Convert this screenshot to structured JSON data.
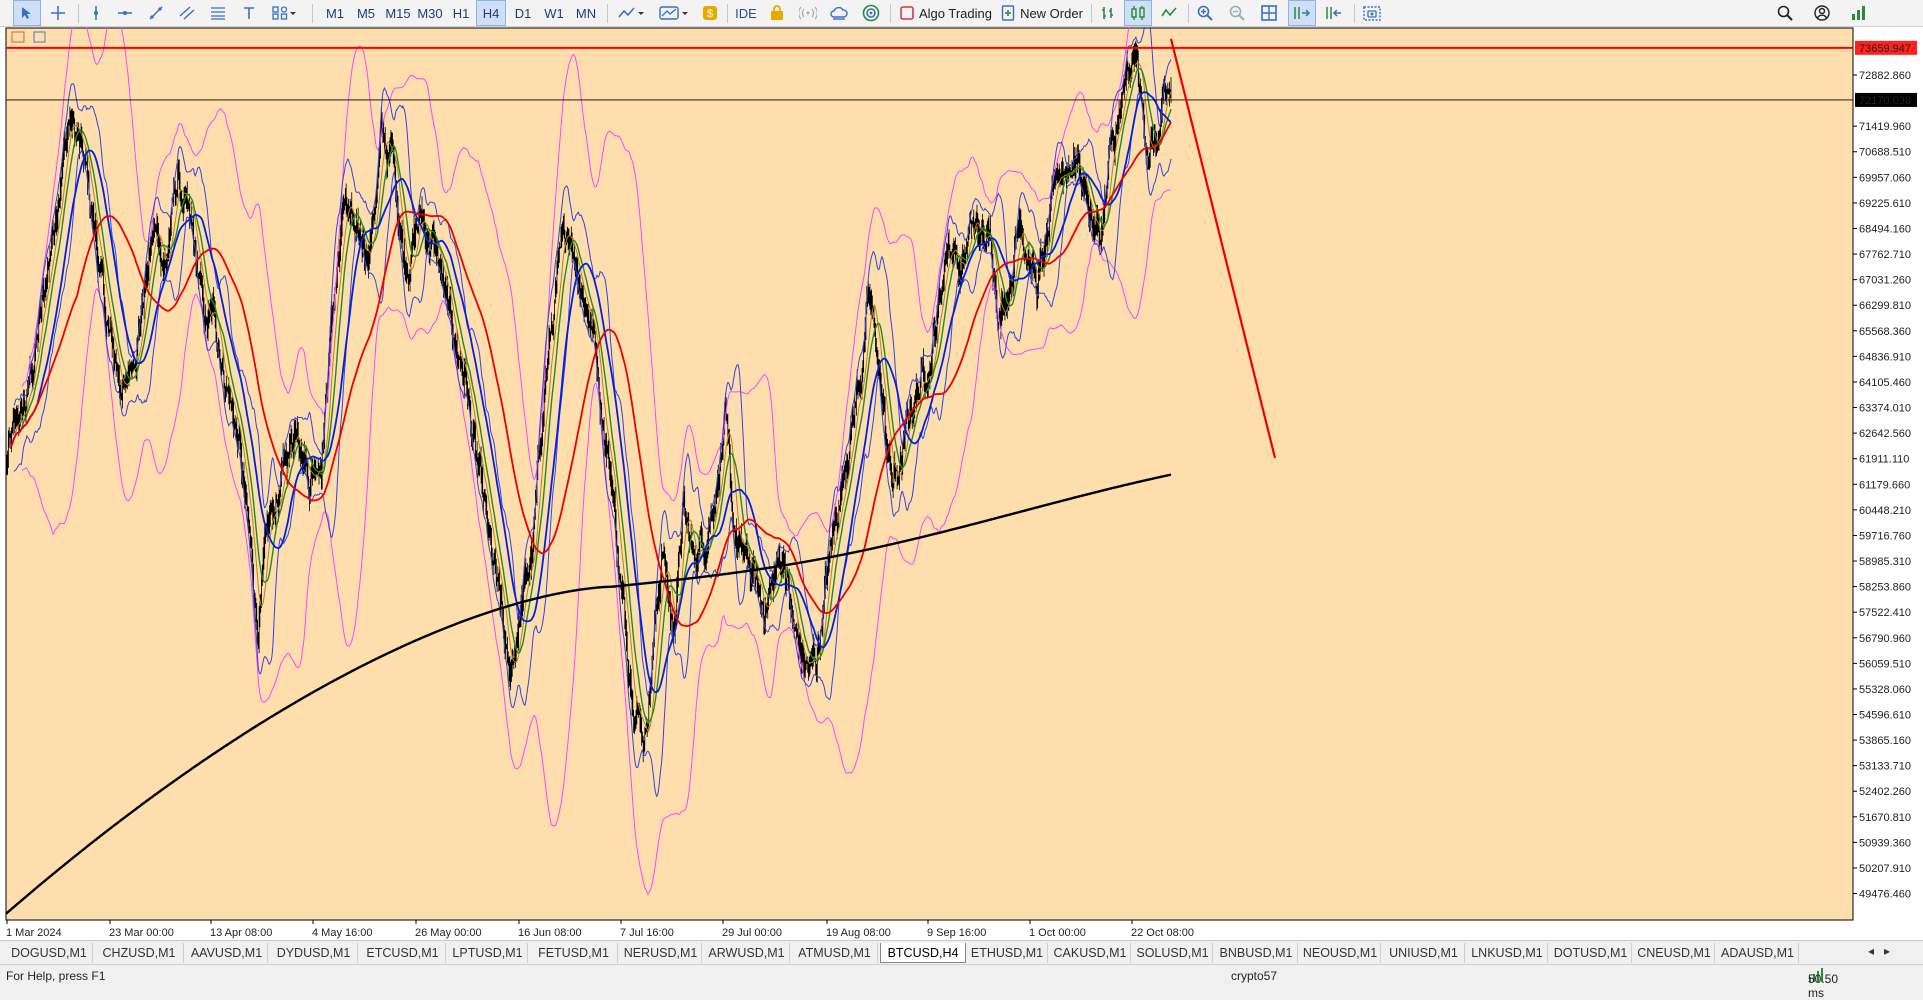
{
  "toolbar": {
    "timeframes": [
      "M1",
      "M5",
      "M15",
      "M30",
      "H1",
      "H4",
      "D1",
      "W1",
      "MN"
    ],
    "active_timeframe": "H4",
    "ide_label": "IDE",
    "algo_trading_label": "Algo Trading",
    "new_order_label": "New Order",
    "icons": [
      "cursor-icon",
      "crosshair-icon",
      "vertical-line-icon",
      "horizontal-line-icon",
      "trendline-icon",
      "channel-icon",
      "fibonacci-icon",
      "text-icon",
      "shapes-icon",
      "indicators-icon",
      "templates-icon",
      "market-icon",
      "lock-icon",
      "signals-icon",
      "cloud-icon",
      "vps-icon",
      "bar-chart-icon",
      "candle-chart-icon",
      "line-chart-icon",
      "zoom-in-icon",
      "zoom-out-icon",
      "tile-windows-icon",
      "autoscroll-icon",
      "chart-shift-icon",
      "screenshot-icon",
      "search-icon",
      "account-icon",
      "signal-level-icon"
    ]
  },
  "chart": {
    "symbol": "BTCUSD,H4",
    "background_color": "#FFDEAD",
    "price_scale": [
      "72882.860",
      "71419.960",
      "70688.510",
      "69957.060",
      "69225.610",
      "68494.160",
      "67762.710",
      "67031.260",
      "66299.810",
      "65568.360",
      "64836.910",
      "64105.460",
      "63374.010",
      "62642.560",
      "61911.110",
      "61179.660",
      "60448.210",
      "59716.760",
      "58985.310",
      "58253.860",
      "57522.410",
      "56790.960",
      "56059.510",
      "55328.060",
      "54596.610",
      "53865.160",
      "53133.710",
      "52402.260",
      "51670.810",
      "50939.360",
      "50207.910",
      "49476.460"
    ],
    "highlight_price_red": "73659.947",
    "current_price": "72170.038",
    "time_scale": [
      "1 Mar 2024",
      "23 Mar 00:00",
      "13 Apr 08:00",
      "4 May 16:00",
      "26 May 00:00",
      "16 Jun 08:00",
      "7 Jul 16:00",
      "29 Jul 00:00",
      "19 Aug 08:00",
      "9 Sep 16:00",
      "1 Oct 00:00",
      "22 Oct 08:00"
    ],
    "colors": {
      "candles": "#000000",
      "bollinger_outer": "#ff44ff",
      "bollinger_inner": "#3344dd",
      "ma_red": "#ee0000",
      "ma_blue": "#0022dd",
      "ma_green": "#228b22",
      "ma_black": "#000000",
      "resistance_line": "#ff0000",
      "projection_line": "#ee0000",
      "current_price_line": "#000000"
    }
  },
  "symbol_tabs": [
    "DOGUSD,M1",
    "CHZUSD,M1",
    "AAVUSD,M1",
    "DYDUSD,M1",
    "ETCUSD,M1",
    "LPTUSD,M1",
    "FETUSD,M1",
    "NERUSD,M1",
    "ARWUSD,M1",
    "ATMUSD,M1",
    "BTCUSD,H4",
    "ETHUSD,M1",
    "CAKUSD,M1",
    "SOLUSD,M1",
    "BNBUSD,M1",
    "NEOUSD,M1",
    "UNIUSD,M1",
    "LNKUSD,M1",
    "DOTUSD,M1",
    "CNEUSD,M1",
    "ADAUSD,M1"
  ],
  "active_tab": "BTCUSD,H4",
  "statusbar": {
    "help_text": "For Help, press F1",
    "profile": "crypto57",
    "ping": "50.50 ms"
  }
}
